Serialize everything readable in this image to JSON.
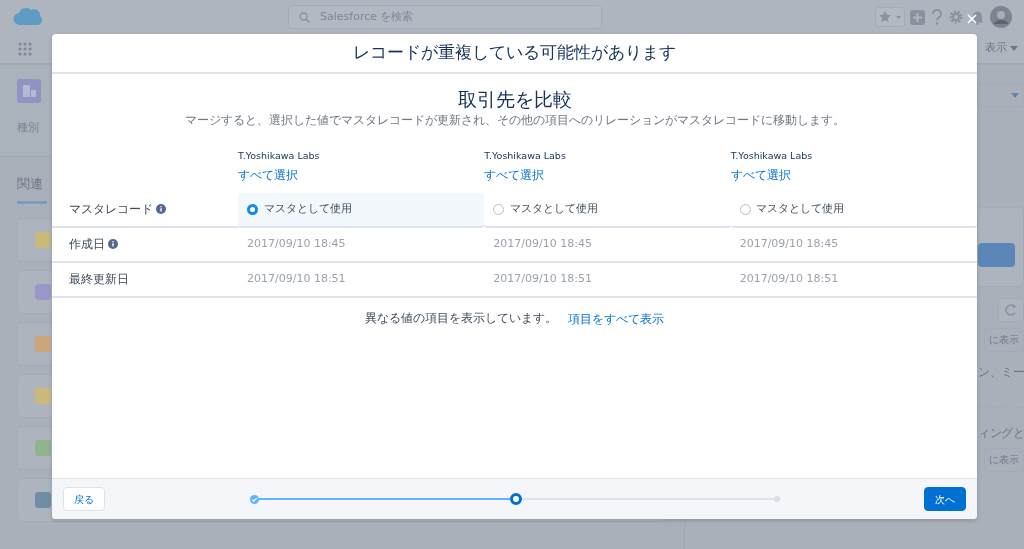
{
  "app_header": {
    "search": {
      "placeholder": "Salesforce を検索"
    }
  },
  "nav": {
    "menu_label": "表示"
  },
  "record": {
    "field_label": "種別"
  },
  "tabs": [
    {
      "label": "関連",
      "selected": true
    }
  ],
  "related_lists": [
    {
      "color": "#c9b97a"
    },
    {
      "color": "#9a98c9"
    },
    {
      "color": "#c9a77a"
    },
    {
      "color": "#c9b97a"
    },
    {
      "color": "#8fb58c"
    },
    {
      "color": "#6f8ea3"
    }
  ],
  "side_panel": {
    "texts": [
      "ン、ミー",
      "ィングと"
    ],
    "buttons": [
      "に表示",
      "に表示"
    ]
  },
  "modal": {
    "title": "レコードが重複している可能性があります",
    "heading": "取引先を比較",
    "description": "マージすると、選択した値でマスタレコードが更新され、その他の項目へのリレーションがマスタレコードに移動します。",
    "field_labels": [
      {
        "label": "マスタレコード",
        "info": true
      },
      {
        "label": "作成日",
        "info": true
      },
      {
        "label": "最終更新日",
        "info": false
      }
    ],
    "records": [
      {
        "name": "T.Yoshikawa Labs",
        "select_all": "すべて選択",
        "selected": true,
        "master_label": "マスタとして使用",
        "created": "2017/09/10 18:45",
        "modified": "2017/09/10 18:51"
      },
      {
        "name": "T.Yoshikawa Labs",
        "select_all": "すべて選択",
        "selected": false,
        "master_label": "マスタとして使用",
        "created": "2017/09/10 18:45",
        "modified": "2017/09/10 18:51"
      },
      {
        "name": "T.Yoshikawa Labs",
        "select_all": "すべて選択",
        "selected": false,
        "master_label": "マスタとして使用",
        "created": "2017/09/10 18:45",
        "modified": "2017/09/10 18:51"
      }
    ],
    "summary": "異なる値の項目を表示しています。",
    "show_all_link": "項目をすべて表示",
    "back_button": "戻る",
    "next_button": "次へ",
    "steps": [
      {
        "completed": true,
        "selected": false
      },
      {
        "completed": false,
        "selected": true
      },
      {
        "completed": false,
        "selected": false
      }
    ]
  }
}
